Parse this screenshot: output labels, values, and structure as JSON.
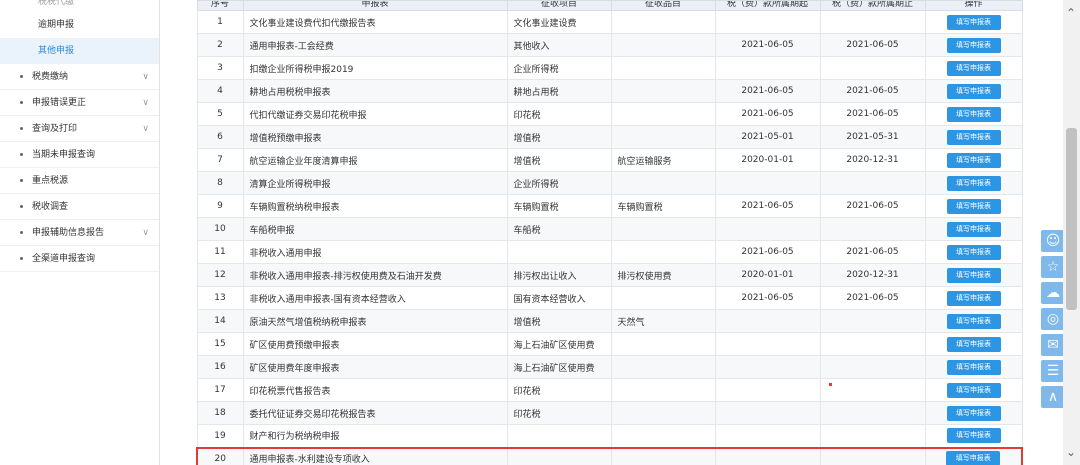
{
  "sidebar": {
    "top_partial": "税税代缴",
    "sub_items": [
      "逾期申报",
      "其他申报"
    ],
    "active_sub": 1,
    "items": [
      {
        "label": "税费缴纳",
        "has_children": true
      },
      {
        "label": "申报错误更正",
        "has_children": true
      },
      {
        "label": "查询及打印",
        "has_children": true
      },
      {
        "label": "当期未申报查询",
        "has_children": false
      },
      {
        "label": "重点税源",
        "has_children": false
      },
      {
        "label": "税收调查",
        "has_children": false
      },
      {
        "label": "申报辅助信息报告",
        "has_children": true
      },
      {
        "label": "全渠道申报查询",
        "has_children": false
      }
    ]
  },
  "table": {
    "headers": [
      "序号",
      "申报表",
      "征收项目",
      "征收品目",
      "税（费）款所属期起",
      "税（费）款所属期止",
      "操作"
    ],
    "button_label": "填写申报表",
    "highlight_row": 19,
    "rows": [
      {
        "no": "1",
        "form": "文化事业建设费代扣代缴报告表",
        "item": "文化事业建设费",
        "sub": "",
        "start": "",
        "end": ""
      },
      {
        "no": "2",
        "form": "通用申报表-工会经费",
        "item": "其他收入",
        "sub": "",
        "start": "2021-06-05",
        "end": "2021-06-05"
      },
      {
        "no": "3",
        "form": "扣缴企业所得税申报2019",
        "item": "企业所得税",
        "sub": "",
        "start": "",
        "end": ""
      },
      {
        "no": "4",
        "form": "耕地占用税税申报表",
        "item": "耕地占用税",
        "sub": "",
        "start": "2021-06-05",
        "end": "2021-06-05"
      },
      {
        "no": "5",
        "form": "代扣代缴证券交易印花税申报",
        "item": "印花税",
        "sub": "",
        "start": "2021-06-05",
        "end": "2021-06-05"
      },
      {
        "no": "6",
        "form": "增值税预缴申报表",
        "item": "增值税",
        "sub": "",
        "start": "2021-05-01",
        "end": "2021-05-31"
      },
      {
        "no": "7",
        "form": "航空运输企业年度清算申报",
        "item": "增值税",
        "sub": "航空运输服务",
        "start": "2020-01-01",
        "end": "2020-12-31"
      },
      {
        "no": "8",
        "form": "清算企业所得税申报",
        "item": "企业所得税",
        "sub": "",
        "start": "",
        "end": ""
      },
      {
        "no": "9",
        "form": "车辆购置税纳税申报表",
        "item": "车辆购置税",
        "sub": "车辆购置税",
        "start": "2021-06-05",
        "end": "2021-06-05"
      },
      {
        "no": "10",
        "form": "车船税申报",
        "item": "车船税",
        "sub": "",
        "start": "",
        "end": ""
      },
      {
        "no": "11",
        "form": "非税收入通用申报",
        "item": "",
        "sub": "",
        "start": "2021-06-05",
        "end": "2021-06-05"
      },
      {
        "no": "12",
        "form": "非税收入通用申报表-排污权使用费及石油开发费",
        "item": "排污权出让收入",
        "sub": "排污权使用费",
        "start": "2020-01-01",
        "end": "2020-12-31"
      },
      {
        "no": "13",
        "form": "非税收入通用申报表-国有资本经营收入",
        "item": "国有资本经营收入",
        "sub": "",
        "start": "2021-06-05",
        "end": "2021-06-05"
      },
      {
        "no": "14",
        "form": "原油天然气增值税纳税申报表",
        "item": "增值税",
        "sub": "天然气",
        "start": "",
        "end": ""
      },
      {
        "no": "15",
        "form": "矿区使用费预缴申报表",
        "item": "海上石油矿区使用费",
        "sub": "",
        "start": "",
        "end": ""
      },
      {
        "no": "16",
        "form": "矿区使用费年度申报表",
        "item": "海上石油矿区使用费",
        "sub": "",
        "start": "",
        "end": ""
      },
      {
        "no": "17",
        "form": "印花税票代售报告表",
        "item": "印花税",
        "sub": "",
        "start": "",
        "end": ""
      },
      {
        "no": "18",
        "form": "委托代征证券交易印花税报告表",
        "item": "印花税",
        "sub": "",
        "start": "",
        "end": ""
      },
      {
        "no": "19",
        "form": "财产和行为税纳税申报",
        "item": "",
        "sub": "",
        "start": "",
        "end": ""
      },
      {
        "no": "20",
        "form": "通用申报表-水利建设专项收入",
        "item": "",
        "sub": "",
        "start": "",
        "end": ""
      }
    ]
  },
  "float_toolbar": [
    "user-icon",
    "star-icon",
    "chat-icon",
    "weibo-icon",
    "message-icon",
    "document-icon",
    "back-to-top-icon"
  ],
  "colors": {
    "accent": "#2c96e4",
    "highlight": "#e53935",
    "active_nav": "#2d8bd8"
  }
}
